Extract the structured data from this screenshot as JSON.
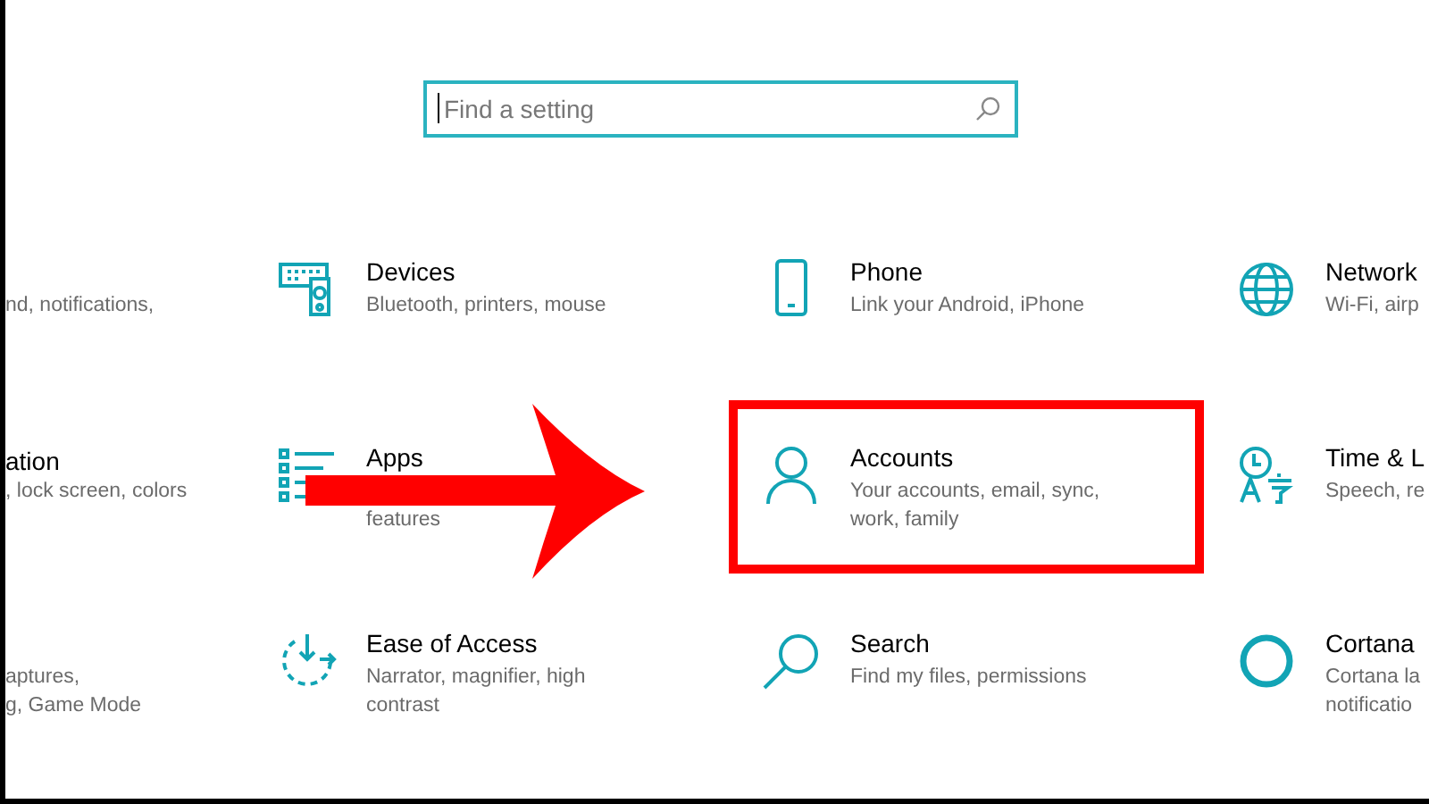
{
  "search": {
    "placeholder": "Find a setting"
  },
  "rows": [
    {
      "partial": {
        "lines": [
          "nd, notifications,"
        ]
      },
      "tiles": [
        {
          "kind": "devices",
          "title": "Devices",
          "lines": [
            "Bluetooth, printers, mouse"
          ],
          "highlighted": false
        },
        {
          "kind": "phone",
          "title": "Phone",
          "lines": [
            "Link your Android, iPhone"
          ],
          "highlighted": false
        },
        {
          "kind": "network",
          "title": "Network",
          "lines": [
            "Wi-Fi, airp"
          ],
          "highlighted": false
        }
      ]
    },
    {
      "partial": {
        "title": "ation",
        "lines": [
          ", lock screen, colors"
        ]
      },
      "tiles": [
        {
          "kind": "apps",
          "title": "Apps",
          "lines": [
            "features"
          ],
          "highlighted": false,
          "first_line_covered": true
        },
        {
          "kind": "accounts",
          "title": "Accounts",
          "lines": [
            "Your accounts, email, sync,",
            "work, family"
          ],
          "highlighted": true
        },
        {
          "kind": "time",
          "title": "Time & L",
          "lines": [
            "Speech, re"
          ],
          "highlighted": false
        }
      ]
    },
    {
      "partial": {
        "lines": [
          "aptures,",
          "g, Game Mode"
        ]
      },
      "tiles": [
        {
          "kind": "ease",
          "title": "Ease of Access",
          "lines": [
            "Narrator, magnifier, high",
            "contrast"
          ],
          "highlighted": false
        },
        {
          "kind": "search",
          "title": "Search",
          "lines": [
            "Find my files, permissions"
          ],
          "highlighted": false
        },
        {
          "kind": "cortana",
          "title": "Cortana",
          "lines": [
            "Cortana la",
            "notificatio"
          ],
          "highlighted": false
        }
      ]
    }
  ]
}
